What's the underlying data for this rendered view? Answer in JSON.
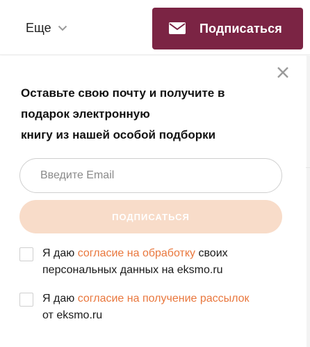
{
  "header": {
    "more_label": "Еще",
    "more_icon": "chevron-down-icon",
    "subscribe_label": "Подписаться",
    "subscribe_icon": "envelope-icon",
    "brand_color": "#7b2444"
  },
  "popup": {
    "close_icon": "close-icon",
    "headline_lines": [
      "Оставьте свою почту и получите в",
      "подарок электронную",
      "книгу из нашей особой подборки"
    ],
    "email_placeholder": "Введите Email",
    "email_value": "",
    "submit_label": "ПОДПИСАТЬСЯ",
    "submit_color": "#f8dcc9",
    "link_color": "#e9773d",
    "consents": [
      {
        "checked": false,
        "prefix": "Я даю ",
        "link": "согласие на обработку",
        "suffix": " своих",
        "line2": "персональных данных на eksmo.ru"
      },
      {
        "checked": false,
        "prefix": "Я даю ",
        "link": "согласие на получение рассылок",
        "suffix": "",
        "line2": "от eksmo.ru"
      }
    ]
  }
}
